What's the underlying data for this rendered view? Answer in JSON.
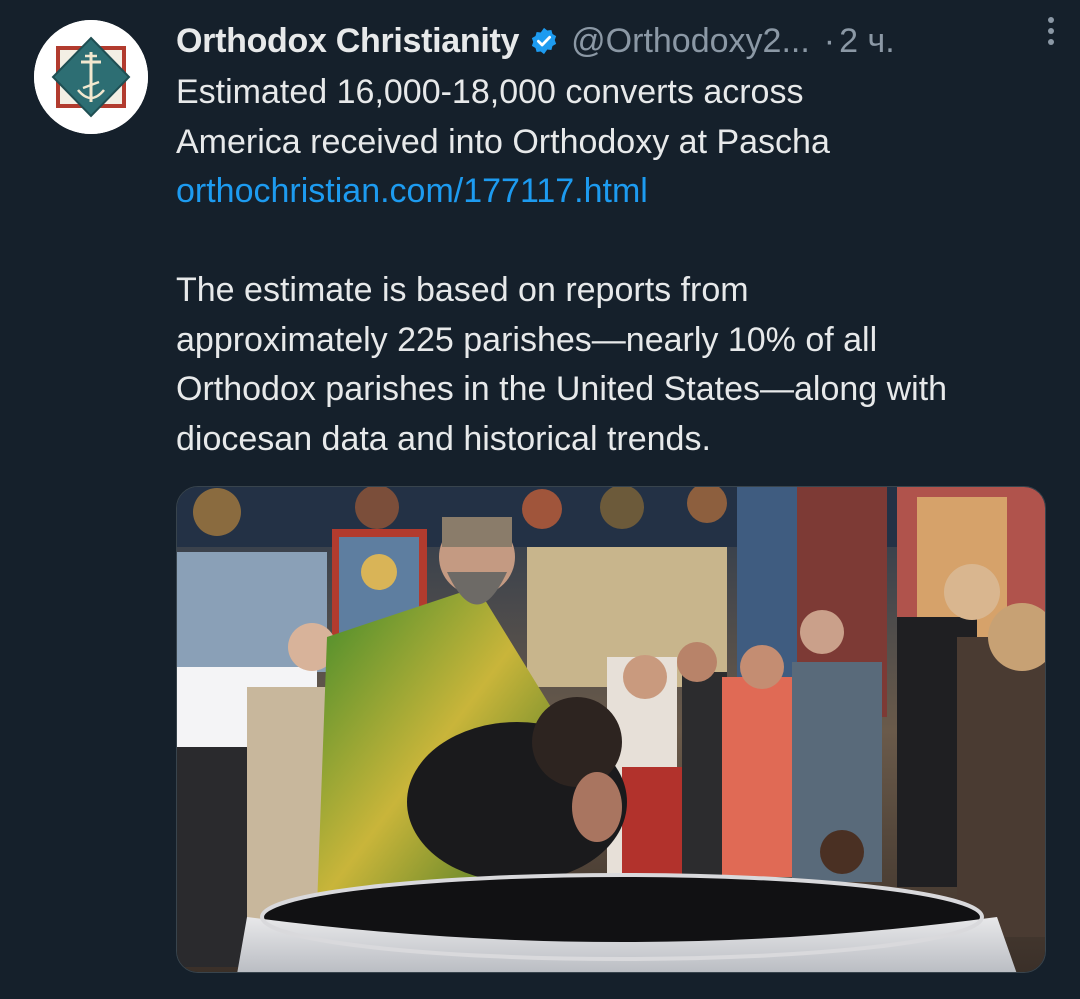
{
  "tweet": {
    "display_name": "Orthodox Christianity",
    "verified_icon": "verified-badge-icon",
    "handle": "@Orthodoxy2...",
    "separator": "·",
    "time": "2 ч.",
    "lines": [
      "Estimated 16,000-18,000 converts across",
      "America received into Orthodoxy at Pascha"
    ],
    "link": "orthochristian.com/177117.html",
    "paragraph": [
      "The estimate is based on reports from",
      "approximately 225 parishes—nearly 10% of all",
      "Orthodox parishes in the United States—along with",
      "diocesan data and historical trends."
    ]
  },
  "icons": {
    "avatar": "orthodox-cross-logo-icon",
    "more": "more-options-icon"
  },
  "colors": {
    "background": "#15202b",
    "text": "#e7e9ea",
    "muted": "#8b98a5",
    "link": "#1d9bf0",
    "verified": "#1d9bf0"
  }
}
